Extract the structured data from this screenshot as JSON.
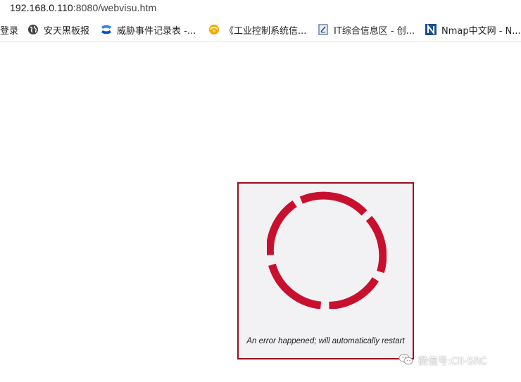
{
  "browser": {
    "address": {
      "host": "192.168.0.110",
      "rest": ":8080/webvisu.htm"
    }
  },
  "bookmarks": [
    {
      "label": "登录",
      "icon": "none"
    },
    {
      "label": "安天黑板报",
      "icon": "globe-icon"
    },
    {
      "label": "威胁事件记录表 -...",
      "icon": "confluence-icon"
    },
    {
      "label": "《工业控制系统信...",
      "icon": "sun-icon"
    },
    {
      "label": "IT综合信息区 - 创...",
      "icon": "page-icon"
    },
    {
      "label": "Nmap中文网 - N...",
      "icon": "n-logo-icon"
    }
  ],
  "error_panel": {
    "message": "An error happened; will automatically restart",
    "accent_color": "#c8102e"
  },
  "watermark": {
    "text": "微信号:CII-SRC"
  }
}
